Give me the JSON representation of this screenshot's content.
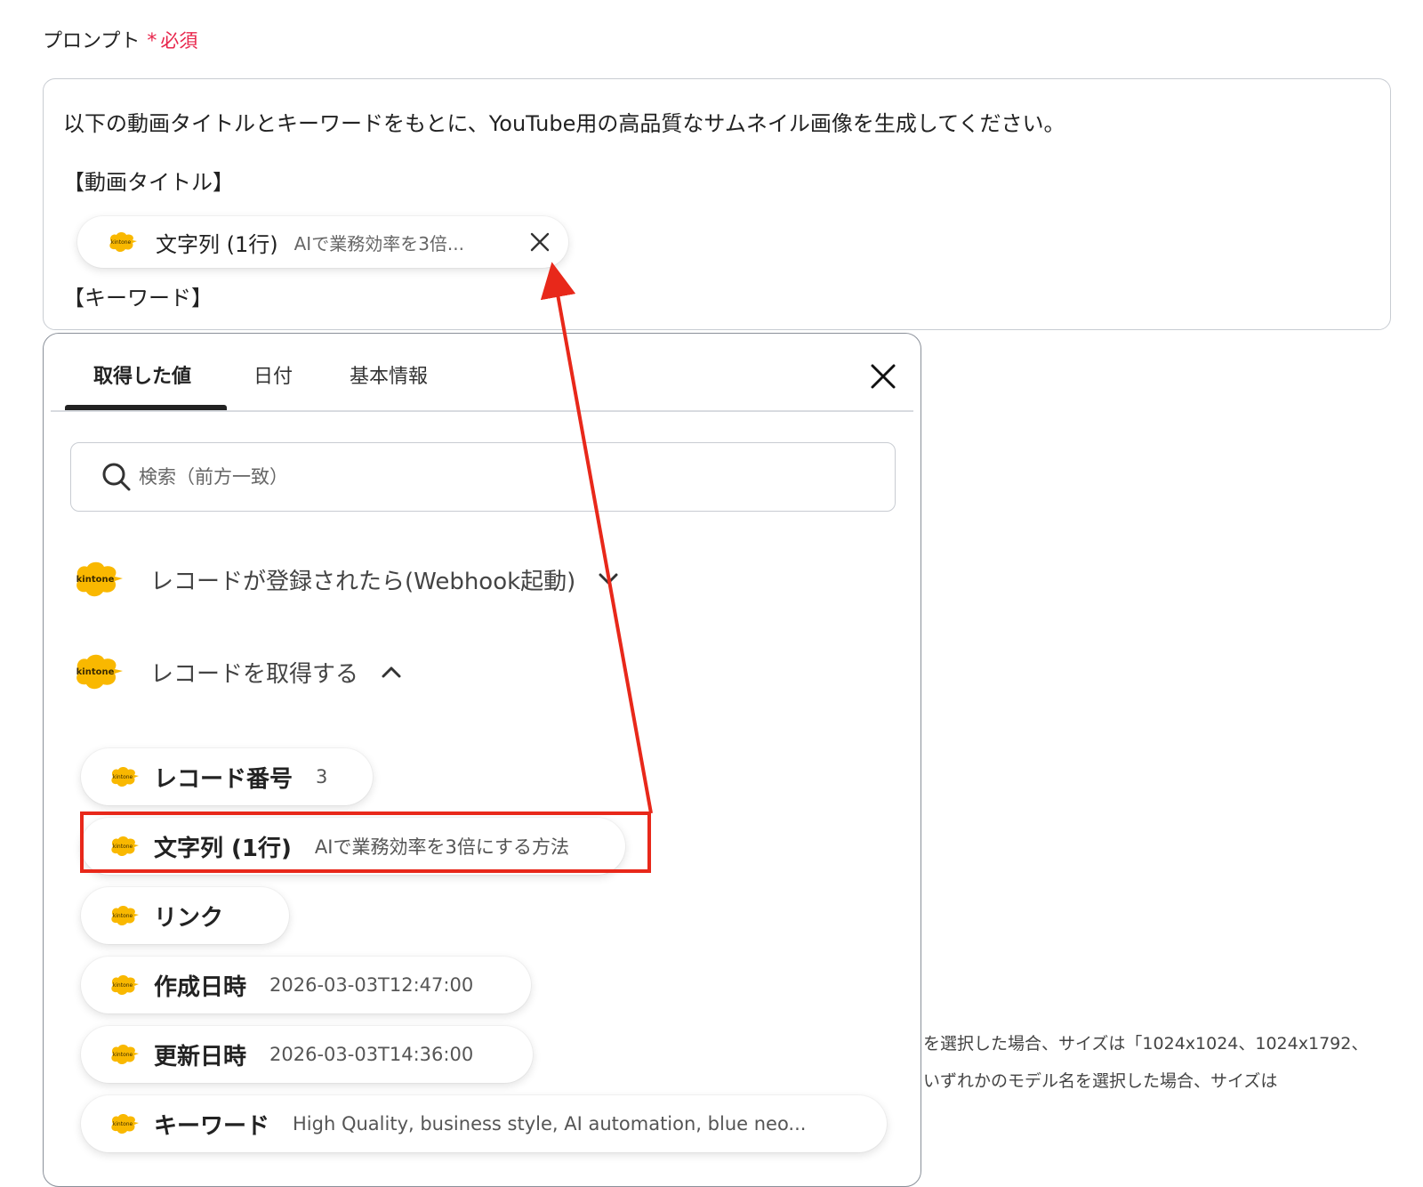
{
  "field": {
    "label": "プロンプト",
    "required_star": "*",
    "required_text": "必須"
  },
  "prompt": {
    "line1": "以下の動画タイトルとキーワードをもとに、YouTube用の高品質なサムネイル画像を生成してください。",
    "line2": "【動画タイトル】",
    "chip": {
      "label": "文字列 (1行)",
      "value": "AIで業務効率を3倍..."
    },
    "line3": "【キーワード】"
  },
  "picker": {
    "tabs": [
      {
        "label": "取得した値",
        "active": true
      },
      {
        "label": "日付",
        "active": false
      },
      {
        "label": "基本情報",
        "active": false
      }
    ],
    "search": {
      "placeholder": "検索（前方一致）"
    },
    "sections": [
      {
        "title": "レコードが登録されたら(Webhook起動)",
        "expanded": false,
        "icon": "kintone-logo"
      },
      {
        "title": "レコードを取得する",
        "expanded": true,
        "icon": "kintone-logo"
      }
    ],
    "items": [
      {
        "label": "レコード番号",
        "value": "3"
      },
      {
        "label": "文字列 (1行)",
        "value": "AIで業務効率を3倍にする方法"
      },
      {
        "label": "リンク",
        "value": ""
      },
      {
        "label": "作成日時",
        "value": "2026-03-03T12:47:00"
      },
      {
        "label": "更新日時",
        "value": "2026-03-03T14:36:00"
      },
      {
        "label": "キーワード",
        "value": "High Quality, business style, AI automation, blue neo..."
      }
    ]
  },
  "background_help": {
    "line1": "を選択した場合、サイズは「1024x1024、1024x1792、",
    "line2": "いずれかのモデル名を選択した場合、サイズは"
  },
  "colors": {
    "required": "#e8254b",
    "annotation": "#e8281a",
    "kintone_yellow": "#f9b800"
  }
}
